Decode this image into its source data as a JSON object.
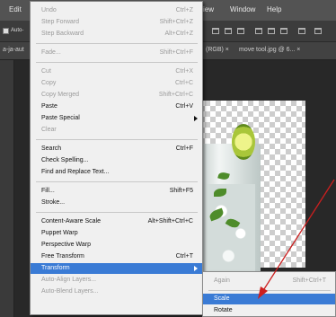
{
  "menubar": {
    "edit": "Edit",
    "view": "iew",
    "window": "Window",
    "help": "Help"
  },
  "optionsbar": {
    "auto_label": "Auto-"
  },
  "tabs": {
    "tab_left": "a-ja-aut",
    "tab_mid": "(RGB) ×",
    "tab_right": "move tool.jpg @ 6... ×"
  },
  "edit_menu": {
    "items": [
      {
        "label": "Undo",
        "shortcut": "Ctrl+Z",
        "disabled": true
      },
      {
        "label": "Step Forward",
        "shortcut": "Shift+Ctrl+Z",
        "disabled": true
      },
      {
        "label": "Step Backward",
        "shortcut": "Alt+Ctrl+Z",
        "disabled": true
      },
      {
        "label": "Fade...",
        "shortcut": "Shift+Ctrl+F",
        "disabled": true
      },
      {
        "label": "Cut",
        "shortcut": "Ctrl+X",
        "disabled": true
      },
      {
        "label": "Copy",
        "shortcut": "Ctrl+C",
        "disabled": true
      },
      {
        "label": "Copy Merged",
        "shortcut": "Shift+Ctrl+C",
        "disabled": true
      },
      {
        "label": "Paste",
        "shortcut": "Ctrl+V",
        "disabled": false
      },
      {
        "label": "Paste Special",
        "shortcut": "",
        "disabled": false,
        "submenu": true
      },
      {
        "label": "Clear",
        "shortcut": "",
        "disabled": true
      },
      {
        "label": "Search",
        "shortcut": "Ctrl+F",
        "disabled": false
      },
      {
        "label": "Check Spelling...",
        "shortcut": "",
        "disabled": false
      },
      {
        "label": "Find and Replace Text...",
        "shortcut": "",
        "disabled": false
      },
      {
        "label": "Fill...",
        "shortcut": "Shift+F5",
        "disabled": false
      },
      {
        "label": "Stroke...",
        "shortcut": "",
        "disabled": false
      },
      {
        "label": "Content-Aware Scale",
        "shortcut": "Alt+Shift+Ctrl+C",
        "disabled": false
      },
      {
        "label": "Puppet Warp",
        "shortcut": "",
        "disabled": false
      },
      {
        "label": "Perspective Warp",
        "shortcut": "",
        "disabled": false
      },
      {
        "label": "Free Transform",
        "shortcut": "Ctrl+T",
        "disabled": false
      },
      {
        "label": "Transform",
        "shortcut": "",
        "disabled": false,
        "submenu": true,
        "selected": true
      },
      {
        "label": "Auto-Align Layers...",
        "shortcut": "",
        "disabled": true
      },
      {
        "label": "Auto-Blend Layers...",
        "shortcut": "",
        "disabled": true
      }
    ]
  },
  "transform_submenu": {
    "items": [
      {
        "label": "Again",
        "shortcut": "Shift+Ctrl+T",
        "disabled": true
      },
      {
        "label": "Scale",
        "shortcut": "",
        "selected": true
      },
      {
        "label": "Rotate",
        "shortcut": ""
      }
    ]
  },
  "colors": {
    "highlight": "#3a7bd5",
    "annotation_arrow": "#cc1f1f"
  }
}
